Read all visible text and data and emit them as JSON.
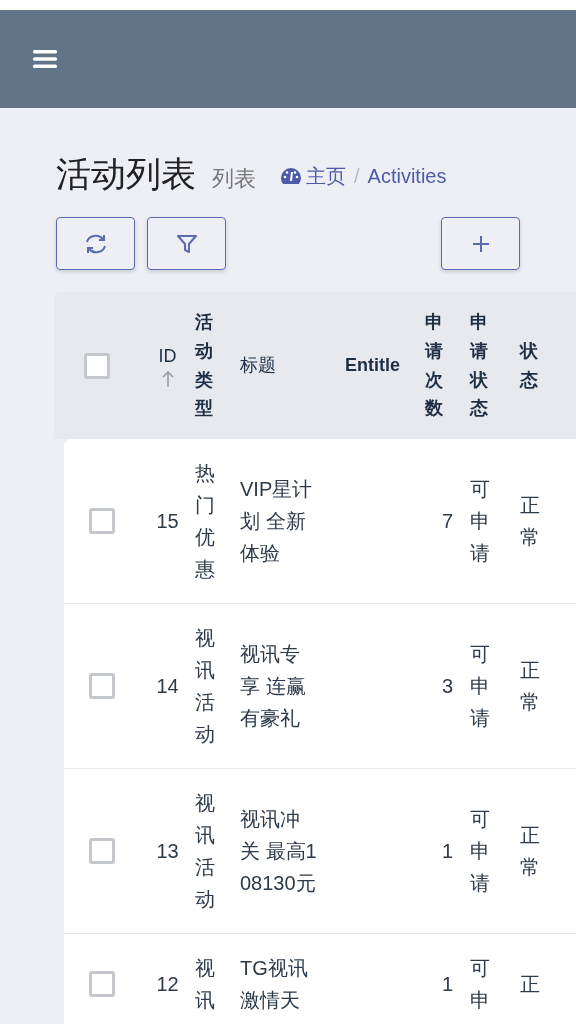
{
  "header": {
    "title": "活动列表",
    "subtitle": "列表",
    "breadcrumb_separator": "/",
    "breadcrumb": [
      {
        "label": "主页",
        "kind": "home"
      },
      {
        "label": "Activities",
        "kind": "page"
      }
    ]
  },
  "select_all": {
    "checked": false
  },
  "columns": [
    {
      "label": "ID",
      "sorted": true
    },
    {
      "label": "活动类型",
      "sorted": false,
      "kind": "vertical"
    },
    {
      "label": "标题",
      "sorted": false
    },
    {
      "label": "Entitle",
      "sorted": false
    },
    {
      "label": "申请次数",
      "sorted": false,
      "kind": "vertical"
    },
    {
      "label": "申请状态",
      "sorted": false,
      "kind": "vertical"
    },
    {
      "label": "状态",
      "sorted": false,
      "kind": "vertical"
    }
  ],
  "rows": [
    {
      "checked": false,
      "id": "15",
      "type": "热门优惠",
      "title": "VIP星计划 全新体验",
      "count": "7",
      "apply_status": "可申请",
      "status": "正常"
    },
    {
      "checked": false,
      "id": "14",
      "type": "视讯活动",
      "title": "视讯专享 连赢有豪礼",
      "count": "3",
      "apply_status": "可申请",
      "status": "正常"
    },
    {
      "checked": false,
      "id": "13",
      "type": "视讯活动",
      "title": "视讯冲关 最高108130元",
      "count": "1",
      "apply_status": "可申请",
      "status": "正常"
    },
    {
      "checked": false,
      "id": "12",
      "type": "视讯",
      "title": "TG视讯激情天",
      "count": "1",
      "apply_status": "可申",
      "status": "正"
    }
  ]
}
